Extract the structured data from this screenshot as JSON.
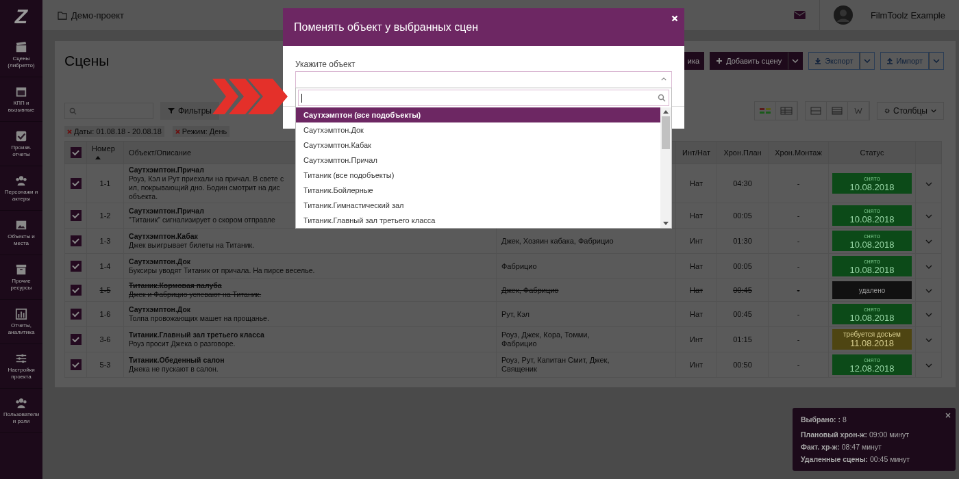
{
  "sidebar": {
    "logo": "Z",
    "items": [
      {
        "label": "Сцены (либретто)",
        "kind": "clapper"
      },
      {
        "label": "КПП и вызывные",
        "kind": "calendar"
      },
      {
        "label": "Произв. отчеты",
        "kind": "check"
      },
      {
        "label": "Персонажи и актеры",
        "kind": "people"
      },
      {
        "label": "Объекты и места",
        "kind": "image"
      },
      {
        "label": "Прочие ресурсы",
        "kind": "archive"
      },
      {
        "label": "Отчеты, аналитика",
        "kind": "chart"
      },
      {
        "label": "Настройки проекта",
        "kind": "sliders"
      },
      {
        "label": "Пользователи и роли",
        "kind": "people"
      }
    ]
  },
  "topbar": {
    "project": "Демо-проект",
    "user": "FilmToolz Example"
  },
  "page": {
    "title": "Сцены",
    "partial_button": "ика",
    "add_button": "Добавить сцену",
    "export_button": "Экспорт",
    "import_button": "Импорт"
  },
  "toolbar": {
    "filters": "Фильтры",
    "columns": "Столбцы"
  },
  "chips": [
    "Даты: 01.08.18 - 20.08.18",
    "Режим: День"
  ],
  "table": {
    "all_checked": true,
    "columns": [
      {
        "label": "Номер",
        "sorted_ascending": true
      },
      {
        "label": "Объект/Описание"
      },
      {},
      {
        "label": "Инт/Нат"
      },
      {
        "label": "Хрон.План"
      },
      {
        "label": "Хрон.Монтаж"
      },
      {
        "label": "Статус"
      }
    ],
    "rows": [
      {
        "checked": true,
        "deleted": false,
        "number": "1-1",
        "object": "Саутхэмптон.Причал",
        "description": [
          "Роуз, Кэл и Рут приехали на причал. В свете с",
          "ил, покрывающий дно. Бодин смотрит на дис",
          "объекта."
        ],
        "int_ext": "Нат",
        "plan": "04:30",
        "edit": "-",
        "status": {
          "kind": "shot",
          "label": "снято",
          "date": "10.08.2018"
        }
      },
      {
        "checked": true,
        "deleted": false,
        "number": "1-2",
        "object": "Саутхэмптон.Причал",
        "description": [
          "\"Титаник\" сигнализирует о скором отправле"
        ],
        "int_ext": "Нат",
        "plan": "00:05",
        "edit": "-",
        "status": {
          "kind": "shot",
          "label": "снято",
          "date": "10.08.2018"
        }
      },
      {
        "checked": true,
        "deleted": false,
        "number": "1-3",
        "object": "Саутхэмптон.Кабак",
        "description": [
          "Джек выигрывает билеты на Титаник."
        ],
        "actors": "Джек, Хозяин кабака, Фабрицио",
        "int_ext": "Инт",
        "plan": "01:30",
        "edit": "-",
        "status": {
          "kind": "shot",
          "label": "снято",
          "date": "10.08.2018"
        }
      },
      {
        "checked": true,
        "deleted": false,
        "number": "1-4",
        "object": "Саутхэмптон.Док",
        "description": [
          "Буксиры уводят Титаник от причала. На пирсе веселье."
        ],
        "actors": "Фабрицио",
        "int_ext": "Нат",
        "plan": "00:05",
        "edit": "-",
        "status": {
          "kind": "shot",
          "label": "снято",
          "date": "10.08.2018"
        }
      },
      {
        "checked": true,
        "deleted": true,
        "number": "1-5",
        "object": "Титаник.Кормовая палуба",
        "description": [
          "Джек и Фабрицио успевают на Титаник."
        ],
        "actors": "Джек, Фабрицио",
        "int_ext": "Нат",
        "plan": "00:45",
        "edit": "-",
        "status": {
          "kind": "deleted",
          "label": "удалено"
        }
      },
      {
        "checked": true,
        "deleted": false,
        "number": "1-6",
        "object": "Саутхэмптон.Док",
        "description": [
          "Толпа провожающих машет на прощанье."
        ],
        "actors": "Рут, Кэл",
        "int_ext": "Нат",
        "plan": "00:45",
        "edit": "-",
        "status": {
          "kind": "shot",
          "label": "снято",
          "date": "10.08.2018"
        }
      },
      {
        "checked": true,
        "deleted": false,
        "number": "3-6",
        "object": "Титаник.Главный зал третьего класса",
        "description": [
          "Роуз просит Джека о разговоре."
        ],
        "actors": "Роуз, Джек, Кора, Томми, Фабрицио",
        "int_ext": "Инт",
        "plan": "01:15",
        "edit": "-",
        "status": {
          "kind": "pending",
          "label": "требуется досъем",
          "date": "11.08.2018"
        }
      },
      {
        "checked": true,
        "deleted": false,
        "number": "5-3",
        "object": "Титаник.Обеденный салон",
        "description": [
          "Джека не пускают в салон."
        ],
        "actors": "Роуз, Рут, Капитан Смит, Джек, Священик",
        "int_ext": "Инт",
        "plan": "00:50",
        "edit": "-",
        "status": {
          "kind": "shot",
          "label": "снято",
          "date": "12.08.2018"
        }
      }
    ]
  },
  "summary": {
    "lines": [
      "**Выбрано: :** 8",
      "**Плановый хрон-ж:** 09:00 минут",
      "**Факт. хр-ж:** 08:47 минут",
      "**Удаленные сцены:** 00:45 минут"
    ]
  },
  "modal": {
    "title": "Поменять объект у выбранных сцен",
    "field_label": "Укажите объект",
    "options": [
      {
        "label": "Саутхэмптон (все подобъекты)",
        "selected": true
      },
      {
        "label": "Саутхэмптон.Док",
        "selected": false
      },
      {
        "label": "Саутхэмптон.Кабак",
        "selected": false
      },
      {
        "label": "Саутхэмптон.Причал",
        "selected": false
      },
      {
        "label": "Титаник (все подобъекты)",
        "selected": false
      },
      {
        "label": "Титаник.Бойлерные",
        "selected": false
      },
      {
        "label": "Титаник.Гимнастический зал",
        "selected": false
      },
      {
        "label": "Титаник.Главный зал третьего класса",
        "selected": false
      }
    ]
  }
}
